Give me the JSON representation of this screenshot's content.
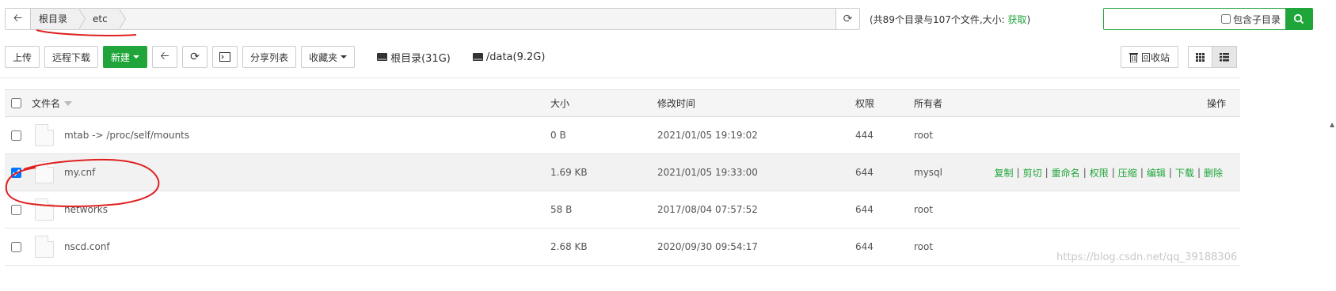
{
  "path_bar": {
    "crumbs": [
      "根目录",
      "etc"
    ]
  },
  "dir_info": {
    "text": "(共89个目录与107个文件,大小: ",
    "fetch": "获取",
    "close": ")"
  },
  "search": {
    "value": "",
    "include_sub_label": "包含子目录"
  },
  "toolbar": {
    "upload": "上传",
    "remote_download": "远程下载",
    "new": "新建",
    "share_list": "分享列表",
    "favorites": "收藏夹",
    "disks": [
      "根目录(31G)",
      "/data(9.2G)"
    ],
    "recycle": "回收站"
  },
  "table": {
    "headers": {
      "name": "文件名",
      "size": "大小",
      "mtime": "修改时间",
      "perm": "权限",
      "owner": "所有者",
      "ops": "操作"
    },
    "rows": [
      {
        "name": "mtab -> /proc/self/mounts",
        "size": "0 B",
        "mtime": "2021/01/05 19:19:02",
        "perm": "444",
        "owner": "root",
        "checked": false
      },
      {
        "name": "my.cnf",
        "size": "1.69 KB",
        "mtime": "2021/01/05 19:33:00",
        "perm": "644",
        "owner": "mysql",
        "checked": true
      },
      {
        "name": "networks",
        "size": "58 B",
        "mtime": "2017/08/04 07:57:52",
        "perm": "644",
        "owner": "root",
        "checked": false
      },
      {
        "name": "nscd.conf",
        "size": "2.68 KB",
        "mtime": "2020/09/30 09:54:17",
        "perm": "644",
        "owner": "root",
        "checked": false
      }
    ],
    "row_actions": [
      "复制",
      "剪切",
      "重命名",
      "权限",
      "压缩",
      "编辑",
      "下载",
      "删除"
    ]
  },
  "watermark": "https://blog.csdn.net/qq_39188306",
  "colors": {
    "accent": "#20a53a",
    "annotation": "#e02020"
  }
}
